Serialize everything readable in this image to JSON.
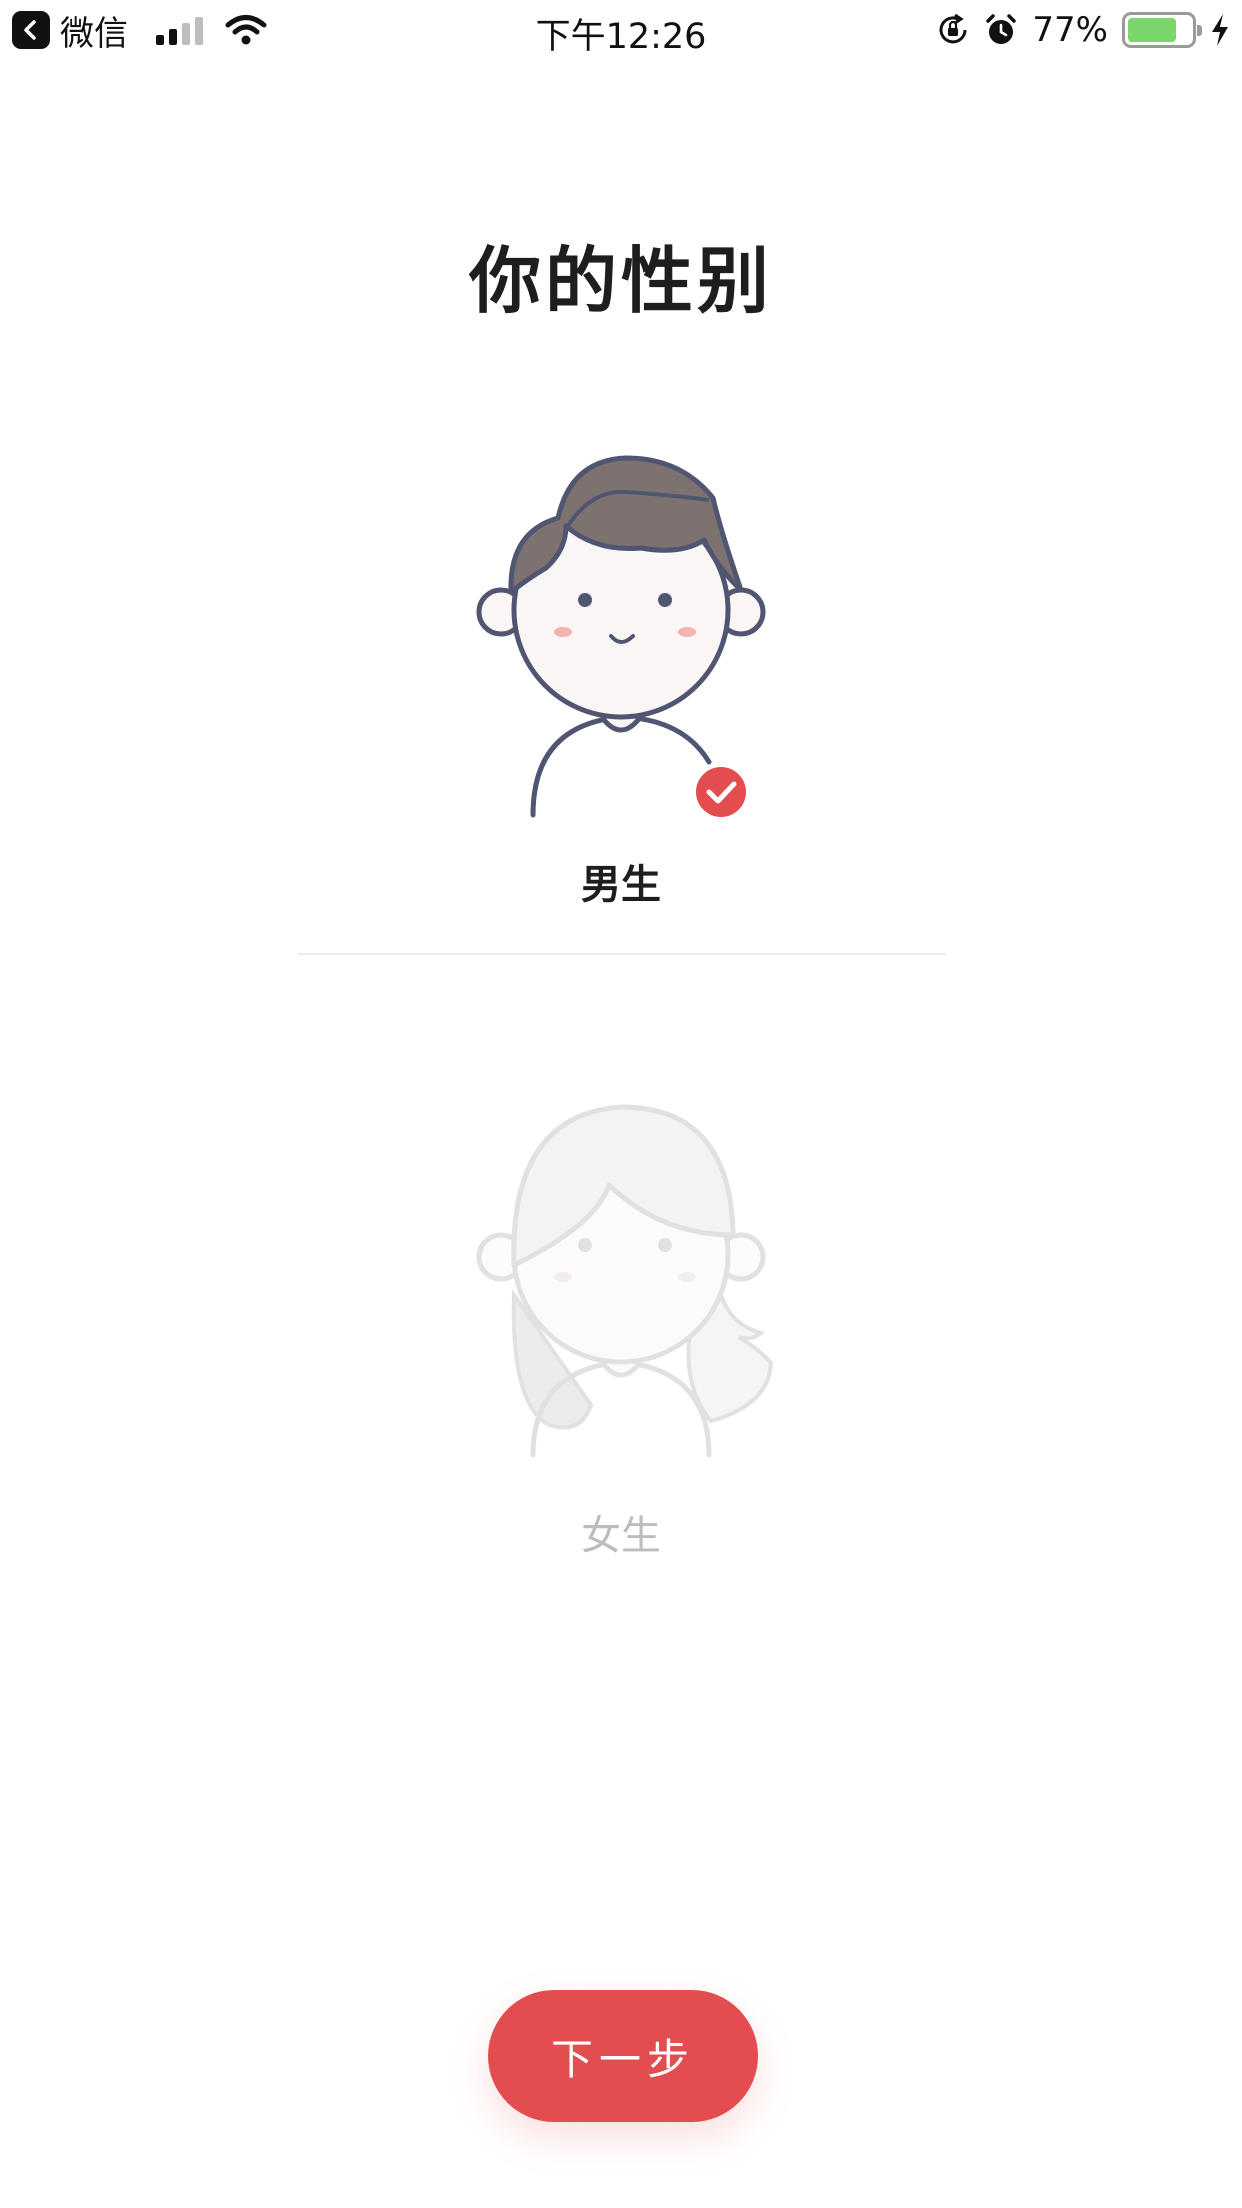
{
  "status_bar": {
    "back_app": "微信",
    "time": "下午12:26",
    "battery_percent": "77%",
    "battery_level": 0.77,
    "icons": [
      "back-arrow-icon",
      "cellular-signal-icon",
      "wifi-icon",
      "rotation-lock-icon",
      "alarm-icon",
      "battery-icon",
      "charging-bolt-icon"
    ]
  },
  "page": {
    "title": "你的性别"
  },
  "options": [
    {
      "label": "男生",
      "selected": true,
      "icon": "male-avatar-icon"
    },
    {
      "label": "女生",
      "selected": false,
      "icon": "female-avatar-icon"
    }
  ],
  "next_button": {
    "label": "下一步"
  },
  "colors": {
    "accent": "#e34d4f",
    "title": "#1e1e1e",
    "muted": "#bdbdbd",
    "outline": "#505672",
    "hair": "#7d726f"
  }
}
